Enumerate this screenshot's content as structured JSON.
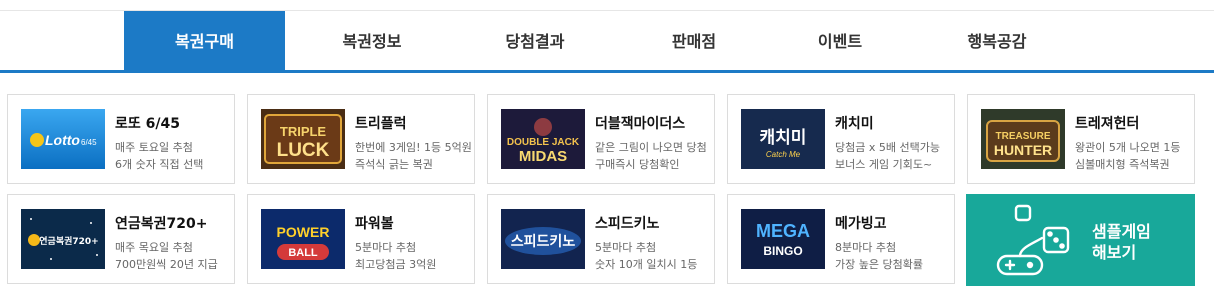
{
  "nav": {
    "items": [
      {
        "label": "복권구매",
        "active": true
      },
      {
        "label": "복권정보",
        "active": false
      },
      {
        "label": "당첨결과",
        "active": false
      },
      {
        "label": "판매점",
        "active": false
      },
      {
        "label": "이벤트",
        "active": false
      },
      {
        "label": "행복공감",
        "active": false
      }
    ]
  },
  "games": [
    {
      "title": "로또 6/45",
      "line1": "매주 토요일 추첨",
      "line2": "6개 숫자 직접 선택",
      "logo": "Lotto6/45"
    },
    {
      "title": "트리플럭",
      "line1": "한번에 3게임! 1등 5억원",
      "line2": "즉석식 긁는 복권",
      "logo_top": "TRIPLE",
      "logo_bottom": "LUCK"
    },
    {
      "title": "더블잭마이더스",
      "line1": "같은 그림이 나오면 당첨",
      "line2": "구매즉시 당첨확인",
      "logo_top": "DOUBLE JACK",
      "logo_bottom": "MIDAS"
    },
    {
      "title": "캐치미",
      "line1": "당첨금 x 5배 선택가능",
      "line2": "보너스 게임 기회도~",
      "logo_top": "캐치미",
      "logo_bottom": "Catch Me"
    },
    {
      "title": "트레져헌터",
      "line1": "왕관이 5개 나오면 1등",
      "line2": "심볼매치형 즉석복권",
      "logo_top": "TREASURE",
      "logo_bottom": "HUNTER"
    },
    {
      "title": "연금복권720+",
      "line1": "매주 목요일 추첨",
      "line2": "700만원씩 20년 지급",
      "logo": "연금복권720+"
    },
    {
      "title": "파워볼",
      "line1": "5분마다 추첨",
      "line2": "최고당첨금 3억원",
      "logo_top": "POWER",
      "logo_bottom": "BALL"
    },
    {
      "title": "스피드키노",
      "line1": "5분마다 추첨",
      "line2": "숫자 10개 일치시 1등",
      "logo": "스피드키노"
    },
    {
      "title": "메가빙고",
      "line1": "8분마다 추첨",
      "line2": "가장 높은 당첨확률",
      "logo_top": "MEGA",
      "logo_bottom": "BINGO"
    }
  ],
  "sample": {
    "line1": "샘플게임",
    "line2": "해보기",
    "icon": "gamepad-dice-icon"
  },
  "colors": {
    "accent": "#1c7ac6",
    "sample_bg": "#18a89a"
  }
}
